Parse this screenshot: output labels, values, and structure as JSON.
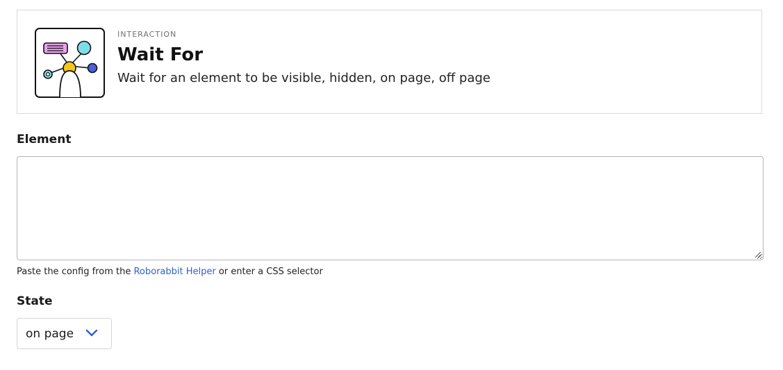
{
  "header": {
    "category": "INTERACTION",
    "title": "Wait For",
    "description": "Wait for an element to be visible, hidden, on page, off page",
    "icon": "wait-for-interaction-icon"
  },
  "element_field": {
    "label": "Element",
    "value": "",
    "help_prefix": "Paste the config from the ",
    "help_link": "Roborabbit Helper",
    "help_suffix": " or enter a CSS selector"
  },
  "state_field": {
    "label": "State",
    "selected": "on page"
  },
  "colors": {
    "link": "#2f5fd0",
    "chevron": "#2f5fd0",
    "icon_pink": "#e9a0f0",
    "icon_cyan": "#7fdcea",
    "icon_yellow": "#f5c518",
    "icon_blue": "#4a5fd8"
  }
}
